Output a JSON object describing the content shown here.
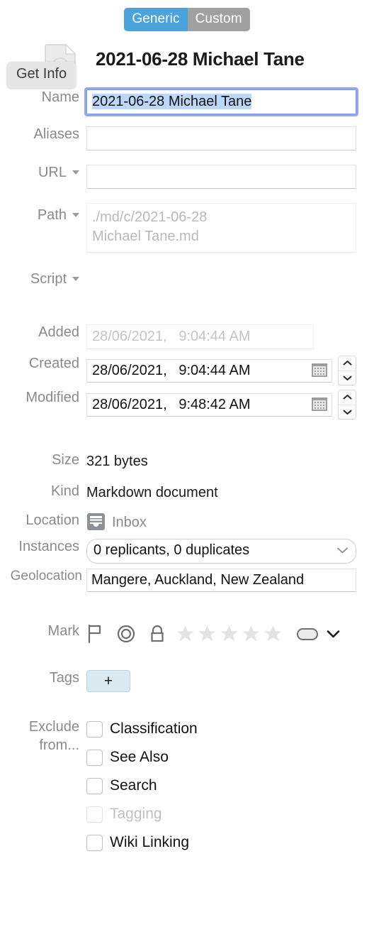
{
  "segmented": {
    "options": [
      {
        "label": "Generic",
        "selected": true
      },
      {
        "label": "Custom",
        "selected": false
      }
    ]
  },
  "tooltip": {
    "text": "Get Info"
  },
  "header": {
    "title": "2021-06-28 Michael Tane",
    "icon": "markdown-document-icon"
  },
  "fields": {
    "name": {
      "label": "Name",
      "value": "2021-06-28 Michael Tane",
      "focused": true,
      "selected": true
    },
    "aliases": {
      "label": "Aliases",
      "value": ""
    },
    "url": {
      "label": "URL",
      "value": "",
      "has_menu": true
    },
    "path": {
      "label": "Path",
      "value": "./md/c/2021-06-28 Michael Tane.md",
      "line1": "./md/c/2021-06-28",
      "line2": "Michael Tane.md",
      "has_menu": true,
      "disabled": true
    },
    "script": {
      "label": "Script",
      "has_menu": true
    },
    "added": {
      "label": "Added",
      "value": "28/06/2021,   9:04:44 AM",
      "disabled": true
    },
    "created": {
      "label": "Created",
      "value": "28/06/2021,   9:04:44 AM",
      "has_calendar": true,
      "has_stepper": true
    },
    "modified": {
      "label": "Modified",
      "value": "28/06/2021,   9:48:42 AM",
      "has_calendar": true,
      "has_stepper": true
    },
    "size": {
      "label": "Size",
      "value": "321 bytes"
    },
    "kind": {
      "label": "Kind",
      "value": "Markdown document"
    },
    "location": {
      "label": "Location",
      "value": "Inbox",
      "icon": "inbox-icon"
    },
    "instances": {
      "label": "Instances",
      "value": "0 replicants, 0 duplicates"
    },
    "geolocation": {
      "label": "Geolocation",
      "value": "Mangere, Auckland, New Zealand"
    }
  },
  "mark": {
    "label": "Mark",
    "icons": [
      "flag-icon",
      "bullseye-icon",
      "lock-icon"
    ],
    "stars": {
      "count": 5,
      "filled": 0
    },
    "label_pill": "label-color-pill",
    "menu": "chevron-down-icon"
  },
  "tags": {
    "label": "Tags",
    "add_label": "+"
  },
  "exclude": {
    "label_line1": "Exclude",
    "label_line2": "from...",
    "items": [
      {
        "label": "Classification",
        "checked": false,
        "disabled": false
      },
      {
        "label": "See Also",
        "checked": false,
        "disabled": false
      },
      {
        "label": "Search",
        "checked": false,
        "disabled": false
      },
      {
        "label": "Tagging",
        "checked": false,
        "disabled": true
      },
      {
        "label": "Wiki Linking",
        "checked": false,
        "disabled": false
      }
    ]
  },
  "colors": {
    "accent_selected": "#4aa3dc",
    "segment_unselected": "#a0a0a0",
    "label_gray": "#8a8a8a",
    "selection_highlight": "#bdd7fb",
    "focus_ring": "#8fa8f0",
    "tag_button_bg": "#dbe9f0"
  }
}
